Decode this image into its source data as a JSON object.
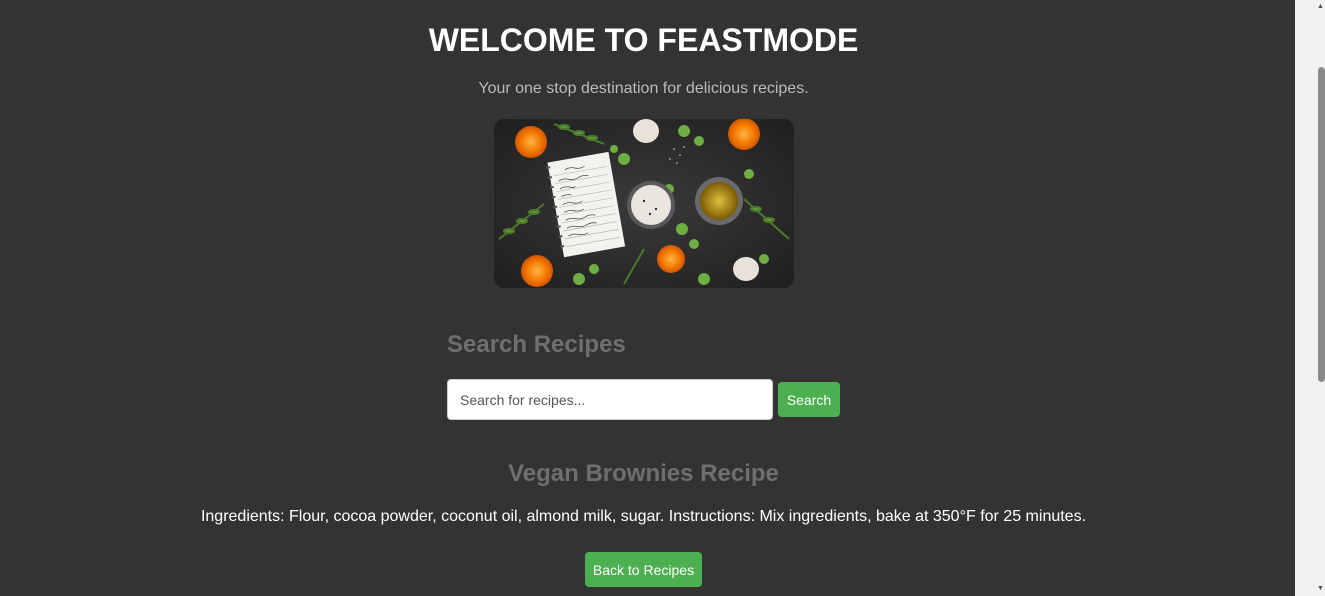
{
  "header": {
    "title": "WELCOME TO FEASTMODE",
    "tagline": "Your one stop destination for delicious recipes."
  },
  "hero_image": {
    "icon": "food-ingredients-photo",
    "note_lines": [
      "Mom's Sauce",
      "Olive Oil",
      "Garlic",
      "Salt",
      "Tomatoes",
      "Fresh Herbs"
    ]
  },
  "search": {
    "heading": "Search Recipes",
    "placeholder": "Search for recipes...",
    "value": "",
    "button_label": "Search"
  },
  "recipe": {
    "title": "Vegan Brownies Recipe",
    "details": "Ingredients: Flour, cocoa powder, coconut oil, almond milk, sugar. Instructions: Mix ingredients, bake at 350°F for 25 minutes.",
    "back_label": "Back to Recipes"
  },
  "colors": {
    "background": "#333333",
    "accent": "#4caf50",
    "heading_muted": "#6f6f6f"
  }
}
